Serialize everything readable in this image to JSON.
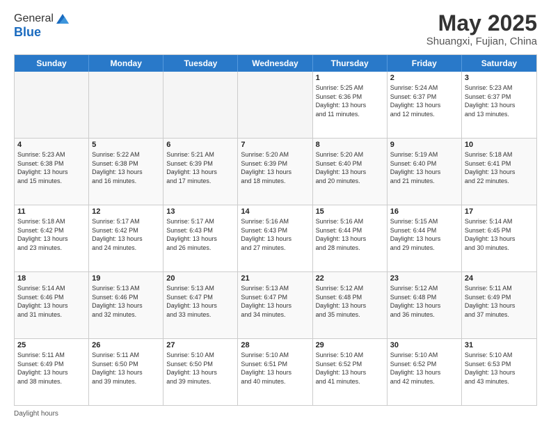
{
  "header": {
    "logo_line1": "General",
    "logo_line2": "Blue",
    "title": "May 2025",
    "location": "Shuangxi, Fujian, China"
  },
  "days_of_week": [
    "Sunday",
    "Monday",
    "Tuesday",
    "Wednesday",
    "Thursday",
    "Friday",
    "Saturday"
  ],
  "weeks": [
    [
      {
        "day": "",
        "info": ""
      },
      {
        "day": "",
        "info": ""
      },
      {
        "day": "",
        "info": ""
      },
      {
        "day": "",
        "info": ""
      },
      {
        "day": "1",
        "info": "Sunrise: 5:25 AM\nSunset: 6:36 PM\nDaylight: 13 hours\nand 11 minutes."
      },
      {
        "day": "2",
        "info": "Sunrise: 5:24 AM\nSunset: 6:37 PM\nDaylight: 13 hours\nand 12 minutes."
      },
      {
        "day": "3",
        "info": "Sunrise: 5:23 AM\nSunset: 6:37 PM\nDaylight: 13 hours\nand 13 minutes."
      }
    ],
    [
      {
        "day": "4",
        "info": "Sunrise: 5:23 AM\nSunset: 6:38 PM\nDaylight: 13 hours\nand 15 minutes."
      },
      {
        "day": "5",
        "info": "Sunrise: 5:22 AM\nSunset: 6:38 PM\nDaylight: 13 hours\nand 16 minutes."
      },
      {
        "day": "6",
        "info": "Sunrise: 5:21 AM\nSunset: 6:39 PM\nDaylight: 13 hours\nand 17 minutes."
      },
      {
        "day": "7",
        "info": "Sunrise: 5:20 AM\nSunset: 6:39 PM\nDaylight: 13 hours\nand 18 minutes."
      },
      {
        "day": "8",
        "info": "Sunrise: 5:20 AM\nSunset: 6:40 PM\nDaylight: 13 hours\nand 20 minutes."
      },
      {
        "day": "9",
        "info": "Sunrise: 5:19 AM\nSunset: 6:40 PM\nDaylight: 13 hours\nand 21 minutes."
      },
      {
        "day": "10",
        "info": "Sunrise: 5:18 AM\nSunset: 6:41 PM\nDaylight: 13 hours\nand 22 minutes."
      }
    ],
    [
      {
        "day": "11",
        "info": "Sunrise: 5:18 AM\nSunset: 6:42 PM\nDaylight: 13 hours\nand 23 minutes."
      },
      {
        "day": "12",
        "info": "Sunrise: 5:17 AM\nSunset: 6:42 PM\nDaylight: 13 hours\nand 24 minutes."
      },
      {
        "day": "13",
        "info": "Sunrise: 5:17 AM\nSunset: 6:43 PM\nDaylight: 13 hours\nand 26 minutes."
      },
      {
        "day": "14",
        "info": "Sunrise: 5:16 AM\nSunset: 6:43 PM\nDaylight: 13 hours\nand 27 minutes."
      },
      {
        "day": "15",
        "info": "Sunrise: 5:16 AM\nSunset: 6:44 PM\nDaylight: 13 hours\nand 28 minutes."
      },
      {
        "day": "16",
        "info": "Sunrise: 5:15 AM\nSunset: 6:44 PM\nDaylight: 13 hours\nand 29 minutes."
      },
      {
        "day": "17",
        "info": "Sunrise: 5:14 AM\nSunset: 6:45 PM\nDaylight: 13 hours\nand 30 minutes."
      }
    ],
    [
      {
        "day": "18",
        "info": "Sunrise: 5:14 AM\nSunset: 6:46 PM\nDaylight: 13 hours\nand 31 minutes."
      },
      {
        "day": "19",
        "info": "Sunrise: 5:13 AM\nSunset: 6:46 PM\nDaylight: 13 hours\nand 32 minutes."
      },
      {
        "day": "20",
        "info": "Sunrise: 5:13 AM\nSunset: 6:47 PM\nDaylight: 13 hours\nand 33 minutes."
      },
      {
        "day": "21",
        "info": "Sunrise: 5:13 AM\nSunset: 6:47 PM\nDaylight: 13 hours\nand 34 minutes."
      },
      {
        "day": "22",
        "info": "Sunrise: 5:12 AM\nSunset: 6:48 PM\nDaylight: 13 hours\nand 35 minutes."
      },
      {
        "day": "23",
        "info": "Sunrise: 5:12 AM\nSunset: 6:48 PM\nDaylight: 13 hours\nand 36 minutes."
      },
      {
        "day": "24",
        "info": "Sunrise: 5:11 AM\nSunset: 6:49 PM\nDaylight: 13 hours\nand 37 minutes."
      }
    ],
    [
      {
        "day": "25",
        "info": "Sunrise: 5:11 AM\nSunset: 6:49 PM\nDaylight: 13 hours\nand 38 minutes."
      },
      {
        "day": "26",
        "info": "Sunrise: 5:11 AM\nSunset: 6:50 PM\nDaylight: 13 hours\nand 39 minutes."
      },
      {
        "day": "27",
        "info": "Sunrise: 5:10 AM\nSunset: 6:50 PM\nDaylight: 13 hours\nand 39 minutes."
      },
      {
        "day": "28",
        "info": "Sunrise: 5:10 AM\nSunset: 6:51 PM\nDaylight: 13 hours\nand 40 minutes."
      },
      {
        "day": "29",
        "info": "Sunrise: 5:10 AM\nSunset: 6:52 PM\nDaylight: 13 hours\nand 41 minutes."
      },
      {
        "day": "30",
        "info": "Sunrise: 5:10 AM\nSunset: 6:52 PM\nDaylight: 13 hours\nand 42 minutes."
      },
      {
        "day": "31",
        "info": "Sunrise: 5:10 AM\nSunset: 6:53 PM\nDaylight: 13 hours\nand 43 minutes."
      }
    ]
  ],
  "footer": {
    "daylight_label": "Daylight hours"
  }
}
